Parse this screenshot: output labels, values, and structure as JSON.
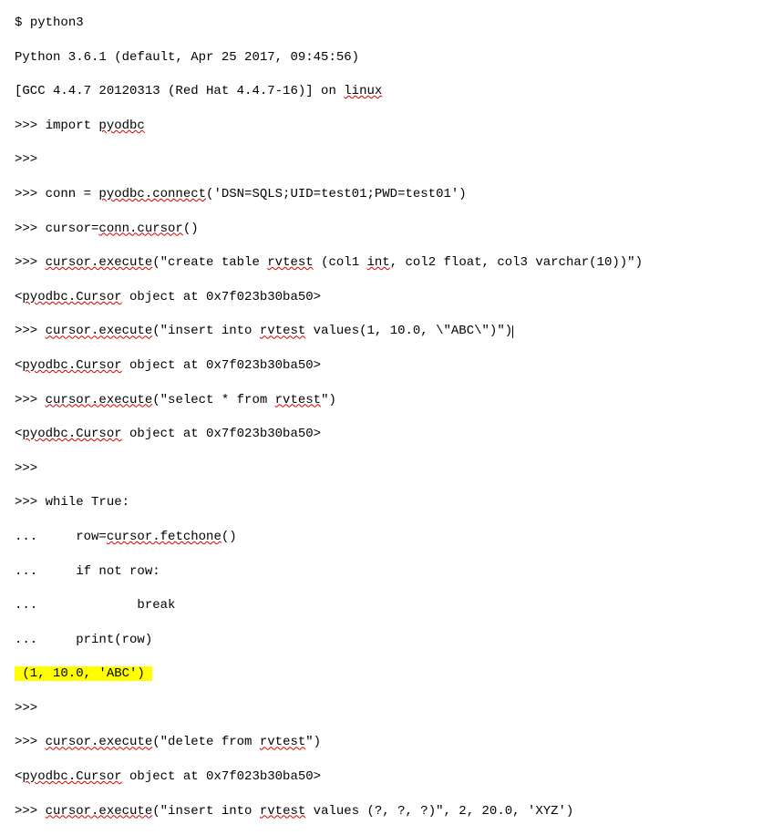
{
  "lines": {
    "l0": {
      "prefix": "$ ",
      "text": "python3"
    },
    "l1": "Python 3.6.1 (default, Apr 25 2017, 09:45:56)",
    "l2a": "[GCC 4.4.7 20120313 (Red Hat 4.4.7-16)] on ",
    "l2b": "linux",
    "l3a": ">>> import ",
    "l3b": "pyodbc",
    "l4": ">>>",
    "l5a": ">>> conn = ",
    "l5b": "pyodbc.connect",
    "l5c": "('DSN=SQLS;UID=test01;PWD=test01')",
    "l6a": ">>> cursor=",
    "l6b": "conn.cursor",
    "l6c": "()",
    "l7a": ">>> ",
    "l7b": "cursor.execute",
    "l7c": "(\"create table ",
    "l7d": "rvtest",
    "l7e": " (col1 ",
    "l7f": "int",
    "l7g": ", col2 float, col3 varchar(10))\")",
    "l8a": "<",
    "l8b": "pyodbc.Cursor",
    "l8c": " object at 0x7f023b30ba50>",
    "l9a": ">>> ",
    "l9b": "cursor.execute",
    "l9c": "(\"insert into ",
    "l9d": "rvtest",
    "l9e": " values(1, 10.0, \\\"ABC\\\")\")",
    "l10a": "<",
    "l10b": "pyodbc.Cursor",
    "l10c": " object at 0x7f023b30ba50>",
    "l11a": ">>> ",
    "l11b": "cursor.execute",
    "l11c": "(\"select * from ",
    "l11d": "rvtest",
    "l11e": "\")",
    "l12a": "<",
    "l12b": "pyodbc.Cursor",
    "l12c": " object at 0x7f023b30ba50>",
    "l13": ">>>",
    "l14": ">>> while True:",
    "l15a": "...     row=",
    "l15b": "cursor.fetchone",
    "l15c": "()",
    "l16": "...     if not row:",
    "l17": "...             break",
    "l18": "...     print(row)",
    "l19": " (1, 10.0, 'ABC') ",
    "l20": ">>>",
    "l21a": ">>> ",
    "l21b": "cursor.execute",
    "l21c": "(\"delete from ",
    "l21d": "rvtest",
    "l21e": "\")",
    "l22a": "<",
    "l22b": "pyodbc.Cursor",
    "l22c": " object at 0x7f023b30ba50>",
    "l23a": ">>> ",
    "l23b": "cursor.execute",
    "l23c": "(\"insert into ",
    "l23d": "rvtest",
    "l23e": " values (?, ?, ?)\", 2, 20.0, 'XYZ')"
  }
}
